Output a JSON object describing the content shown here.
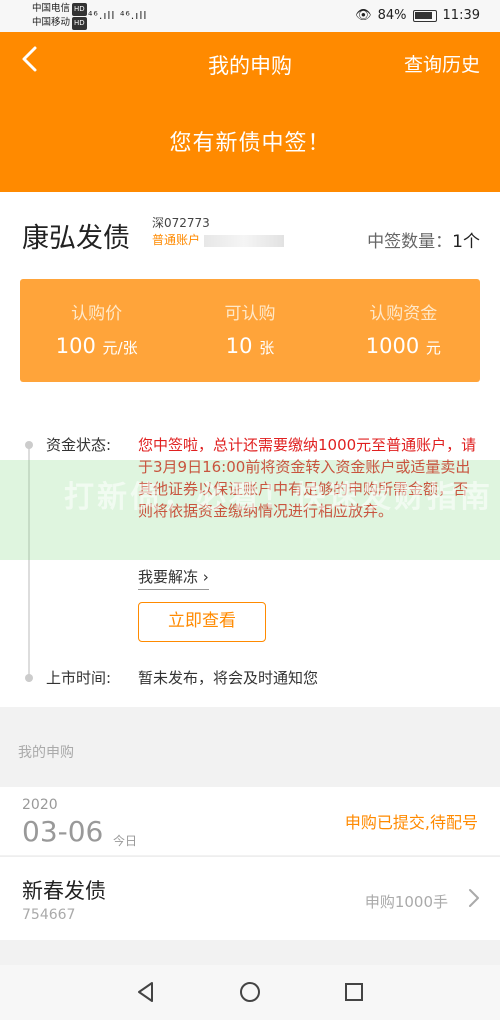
{
  "status_bar": {
    "carrier1": "中国电信",
    "carrier2": "中国移动",
    "hd": "HD",
    "signals": "⁴⁶.ıll ⁴⁶.ıll",
    "battery": "84%",
    "time": "11:39"
  },
  "header": {
    "title": "我的申购",
    "history": "查询历史",
    "win_message": "您有新债中签！"
  },
  "bond": {
    "name": "康弘发债",
    "code": "深072773",
    "account_label": "普通账户",
    "win_count_label": "中签数量：",
    "win_count_value": "1个"
  },
  "info": {
    "price_label": "认购价",
    "price_value": "100",
    "price_unit": "元/张",
    "qty_label": "可认购",
    "qty_value": "10",
    "qty_unit": "张",
    "fund_label": "认购资金",
    "fund_value": "1000",
    "fund_unit": "元"
  },
  "detail": {
    "fund_status_label": "资金状态:",
    "fund_status_text": "您中签啦，总计还需要缴纳1000元至普通账户，请于3月9日16:00前将资金转入资金账户或适量卖出其他证券以保证账户中有足够的申购所需金额，否则将依据资金缴纳情况进行相应放弃。",
    "thaw_link": "我要解冻",
    "view_button": "立即查看",
    "listing_label": "上市时间:",
    "listing_text": "暂未发布，将会及时通知您"
  },
  "watermark": "打新债，必看！快速发财指南",
  "my_subscriptions": {
    "section_title": "我的申购",
    "year": "2020",
    "date": "03-06",
    "today": "今日",
    "status": "申购已提交,待配号",
    "item_name": "新春发债",
    "item_code": "754667",
    "item_amount": "申购1000手"
  },
  "colors": {
    "brand_orange": "#ff8a00",
    "box_orange": "#ffa43a",
    "alert_red": "#e02020"
  }
}
